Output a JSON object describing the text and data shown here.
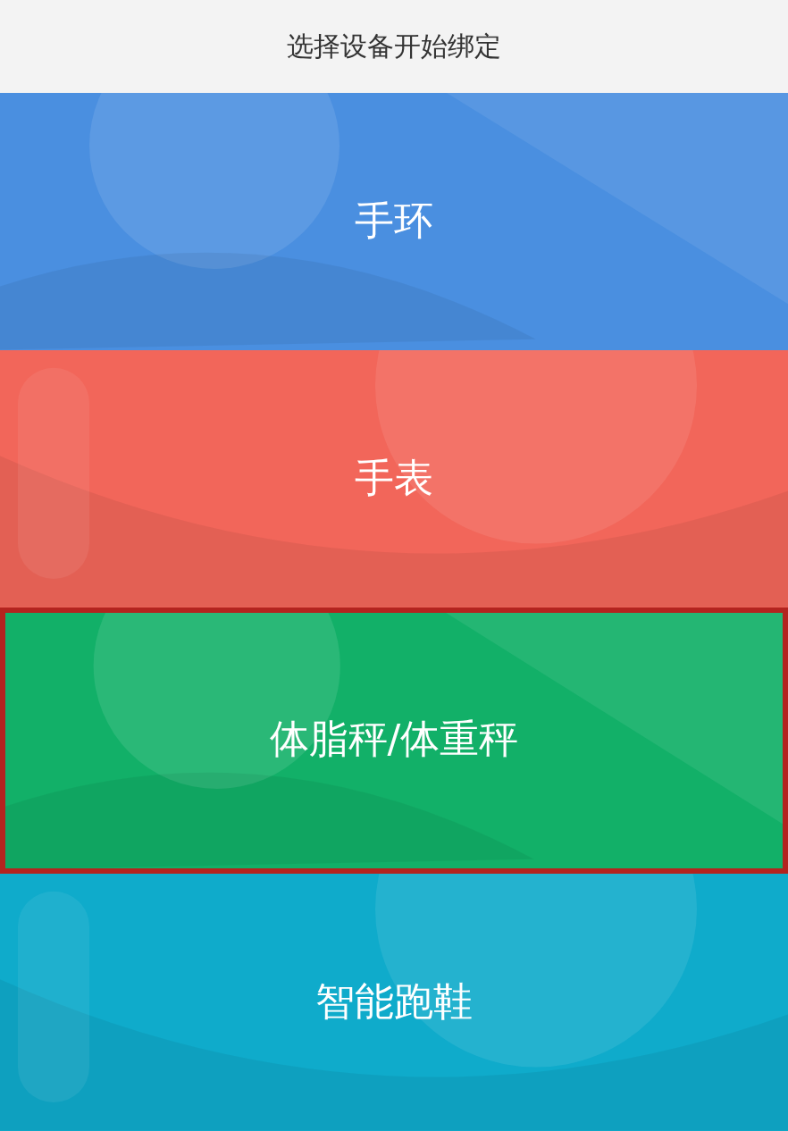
{
  "header": {
    "title": "选择设备开始绑定"
  },
  "devices": [
    {
      "label": "手环",
      "color": "#4a8fe0",
      "selected": false
    },
    {
      "label": "手表",
      "color": "#f2665a",
      "selected": false
    },
    {
      "label": "体脂秤/体重秤",
      "color": "#12b068",
      "selected": true
    },
    {
      "label": "智能跑鞋",
      "color": "#0fabcb",
      "selected": false
    }
  ]
}
